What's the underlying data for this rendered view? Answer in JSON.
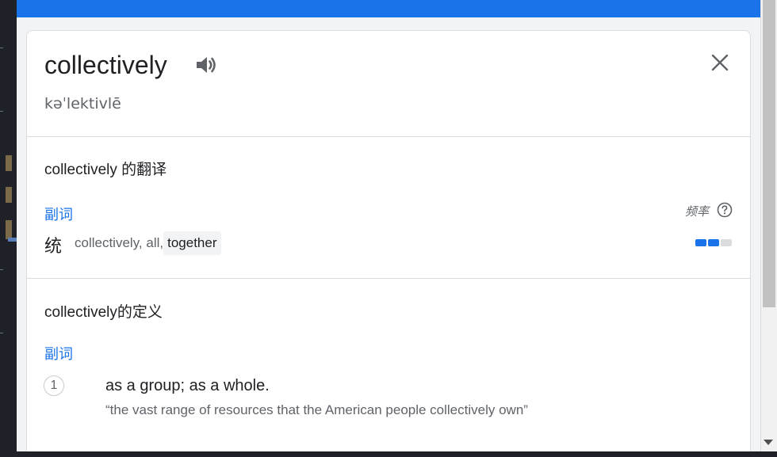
{
  "entry": {
    "word": "collectively",
    "phonetic": "kəˈlektivlē"
  },
  "translation": {
    "section_title": "collectively 的翻译",
    "part_of_speech": "副词",
    "frequency_label": "频率",
    "translated_word": "统",
    "synonyms_prefix": "collectively, all,",
    "synonym_highlight": "together",
    "frequency_level": 2,
    "frequency_max": 3
  },
  "definition": {
    "section_title": "collectively的定义",
    "part_of_speech": "副词",
    "items": [
      {
        "number": "1",
        "gloss": "as a group; as a whole.",
        "example": "“the vast range of resources that the American people collectively own”"
      }
    ]
  },
  "colors": {
    "accent": "#1a73e8",
    "freq_on": "#1a73e8",
    "freq_off": "#dadce0"
  },
  "icons": {
    "speaker": "volume-up-icon",
    "close": "close-icon",
    "help": "help-circle-icon"
  }
}
